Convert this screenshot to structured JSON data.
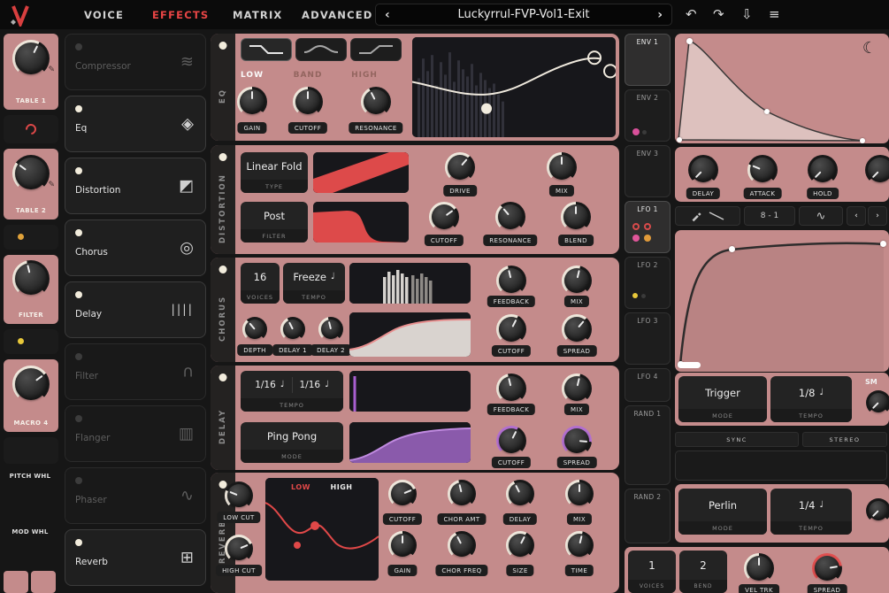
{
  "topbar": {
    "tabs": [
      {
        "label": "VOICE"
      },
      {
        "label": "EFFECTS"
      },
      {
        "label": "MATRIX"
      },
      {
        "label": "ADVANCED"
      }
    ],
    "active_tab": "EFFECTS",
    "preset": {
      "name": "Luckyrrul-FVP-Vol1-Exit",
      "prev": "‹",
      "next": "›"
    },
    "actions": {
      "undo": "↶",
      "redo": "↷",
      "save": "⇩",
      "menu": "≡"
    }
  },
  "left_rail": {
    "table1": "TABLE 1",
    "table2": "TABLE 2",
    "filter": "FILTER",
    "macro4": "MACRO 4",
    "pitch_whl": "PITCH WHL",
    "mod_whl": "MOD WHL"
  },
  "effects_list": [
    {
      "label": "Compressor",
      "icon": "≋",
      "enabled": false
    },
    {
      "label": "Eq",
      "icon": "◈",
      "enabled": true
    },
    {
      "label": "Distortion",
      "icon": "◩",
      "enabled": true
    },
    {
      "label": "Chorus",
      "icon": "◎",
      "enabled": true
    },
    {
      "label": "Delay",
      "icon": "||||",
      "enabled": true
    },
    {
      "label": "Filter",
      "icon": "∩",
      "enabled": false
    },
    {
      "label": "Flanger",
      "icon": "▥",
      "enabled": false
    },
    {
      "label": "Phaser",
      "icon": "∿",
      "enabled": false
    },
    {
      "label": "Reverb",
      "icon": "⊞",
      "enabled": true
    }
  ],
  "eq": {
    "title": "EQ",
    "low": "LOW",
    "band": "BAND",
    "high": "HIGH",
    "selected_band": "LOW",
    "gain": "GAIN",
    "cutoff": "CUTOFF",
    "resonance": "RESONANCE"
  },
  "distortion": {
    "title": "DISTORTION",
    "type_value": "Linear Fold",
    "type_label": "TYPE",
    "filter_value": "Post",
    "filter_label": "FILTER",
    "drive": "DRIVE",
    "mix": "MIX",
    "cutoff": "CUTOFF",
    "resonance": "RESONANCE",
    "blend": "BLEND"
  },
  "chorus": {
    "title": "CHORUS",
    "voices_value": "16",
    "voices_label": "VOICES",
    "tempo_value": "Freeze",
    "tempo_note": "♩",
    "tempo_label": "TEMPO",
    "feedback": "FEEDBACK",
    "mix": "MIX",
    "depth": "DEPTH",
    "delay1": "DELAY 1",
    "delay2": "DELAY 2",
    "cutoff": "CUTOFF",
    "spread": "SPREAD"
  },
  "delay": {
    "title": "DELAY",
    "tempo1": "1/16",
    "note1": "♩",
    "tempo2": "1/16",
    "note2": "♩",
    "tempo_label": "TEMPO",
    "mode_value": "Ping Pong",
    "mode_label": "MODE",
    "feedback": "FEEDBACK",
    "mix": "MIX",
    "cutoff": "CUTOFF",
    "spread": "SPREAD"
  },
  "reverb": {
    "title": "REVERB",
    "low_cut": "LOW CUT",
    "high_cut": "HIGH CUT",
    "graph_low": "LOW",
    "graph_high": "HIGH",
    "cutoff": "CUTOFF",
    "chor_amt": "CHOR AMT",
    "delay": "DELAY",
    "mix": "MIX",
    "gain": "GAIN",
    "chor_freq": "CHOR FREQ",
    "size": "SIZE",
    "time": "TIME"
  },
  "mod_sources": [
    {
      "label": "ENV 1",
      "selected": true
    },
    {
      "label": "ENV 2",
      "selected": false
    },
    {
      "label": "ENV 3",
      "selected": false
    },
    {
      "label": "LFO 1",
      "selected": true
    },
    {
      "label": "LFO 2",
      "selected": false
    },
    {
      "label": "LFO 3",
      "selected": false
    },
    {
      "label": "LFO 4",
      "selected": false
    },
    {
      "label": "RAND 1",
      "selected": false
    },
    {
      "label": "RAND 2",
      "selected": false
    }
  ],
  "env": {
    "delay": "DELAY",
    "attack": "ATTACK",
    "hold": "HOLD",
    "moon": "☾"
  },
  "lfo": {
    "grid": "8 - 1",
    "paint": "∿",
    "prev": "‹",
    "next": "›",
    "mode_value": "Trigger",
    "mode_label": "MODE",
    "tempo_value": "1/8",
    "tempo_note": "♩",
    "tempo_label": "TEMPO",
    "smooth_partial": "SM"
  },
  "rand": {
    "sync": "SYNC",
    "stereo": "STEREO",
    "mode_value": "Perlin",
    "mode_label": "MODE",
    "tempo_value": "1/4",
    "tempo_note": "♩",
    "tempo_label": "TEMPO"
  },
  "bottom": {
    "voices_value": "1",
    "voices_label": "VOICES",
    "bend_value": "2",
    "bend_label": "BEND",
    "vel_trk": "VEL TRK",
    "spread": "SPREAD"
  },
  "colors": {
    "accent_red": "#e84545",
    "panel_salmon": "#c48b8b",
    "purple": "#a85fd0",
    "cream": "#efe8dc"
  }
}
